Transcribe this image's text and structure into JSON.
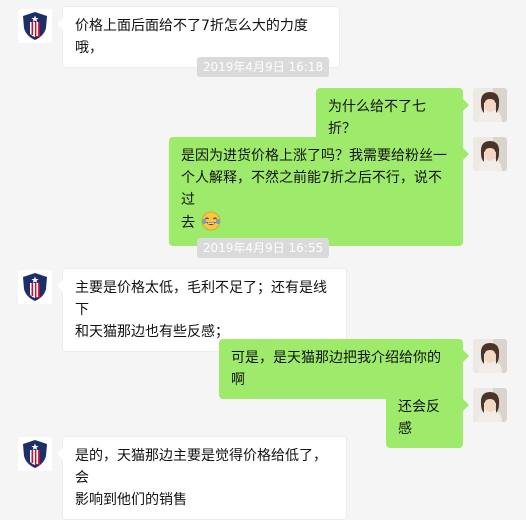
{
  "conversation": {
    "messages": [
      {
        "side": "left",
        "text": "价格上面后面给不了7折怎么大的力度哦，"
      },
      {
        "type": "timestamp",
        "text": "2019年4月9日 16:18"
      },
      {
        "side": "right",
        "text": "为什么给不了七折？"
      },
      {
        "side": "right",
        "lines": [
          "是因为进货价格上涨了吗？我需要给粉丝一",
          "个人解释，不然之前能7折之后不行，说不过",
          "去"
        ],
        "emoji": "tears-of-joy-emoji"
      },
      {
        "type": "timestamp",
        "text": "2019年4月9日 16:55"
      },
      {
        "side": "left",
        "lines": [
          "主要是价格太低，毛利不足了；还有是线下",
          "和天猫那边也有些反感；"
        ]
      },
      {
        "side": "right",
        "text": "可是，是天猫那边把我介绍给你的啊"
      },
      {
        "side": "right",
        "text": "还会反感"
      },
      {
        "side": "left",
        "lines": [
          "是的，天猫那边主要是觉得价格给低了，会",
          "影响到他们的销售"
        ]
      }
    ]
  },
  "avatars": {
    "left": "shield-logo-icon",
    "right": "user-photo-avatar"
  },
  "colors": {
    "background": "#f5f5f5",
    "incoming_bubble": "#ffffff",
    "outgoing_bubble": "#9eea6a",
    "timestamp_bg": "#dadada",
    "timestamp_text": "#ffffff"
  }
}
